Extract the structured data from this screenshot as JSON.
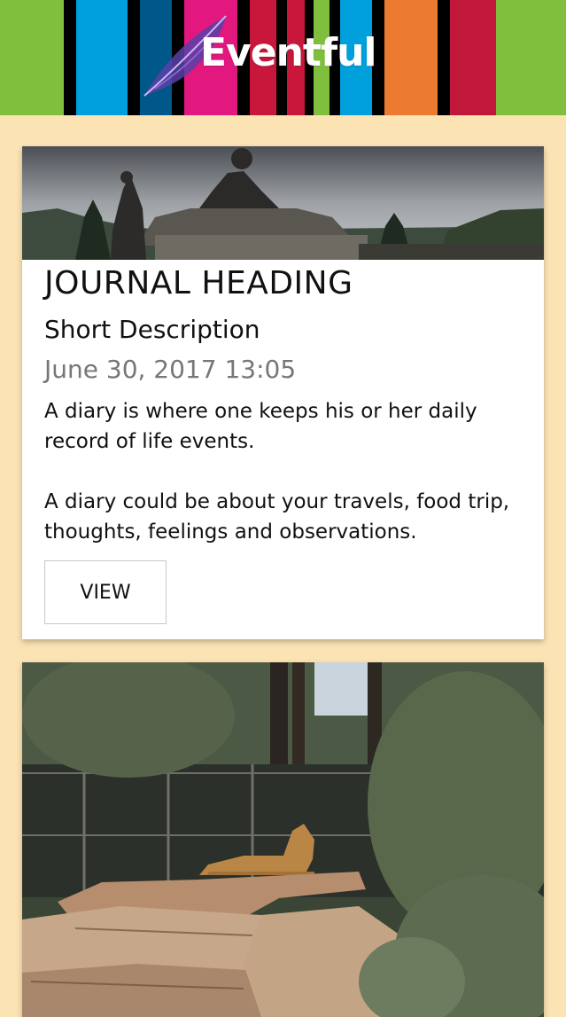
{
  "header": {
    "brand": "Eventful",
    "colors": [
      "#000000",
      "#00a0dc",
      "#000000",
      "#00578a",
      "#000000",
      "#e2187f",
      "#000000",
      "#c8173b",
      "#000000",
      "#c8173b",
      "#000000",
      "#80bf3e",
      "#000000",
      "#00a0dc",
      "#000000",
      "#ec7b31",
      "#000000",
      "#c1173b"
    ]
  },
  "cards": [
    {
      "image": "buddha-statue-photo",
      "title": "JOURNAL HEADING",
      "short_description": "Short Description",
      "date": "June 30, 2017 13:05",
      "body": "A diary is where one keeps his or her daily record of life events.\n\nA diary could be about your travels, food trip, thoughts, feelings and observations.",
      "button_label": "VIEW"
    },
    {
      "image": "lion-on-rocks-photo"
    }
  ]
}
